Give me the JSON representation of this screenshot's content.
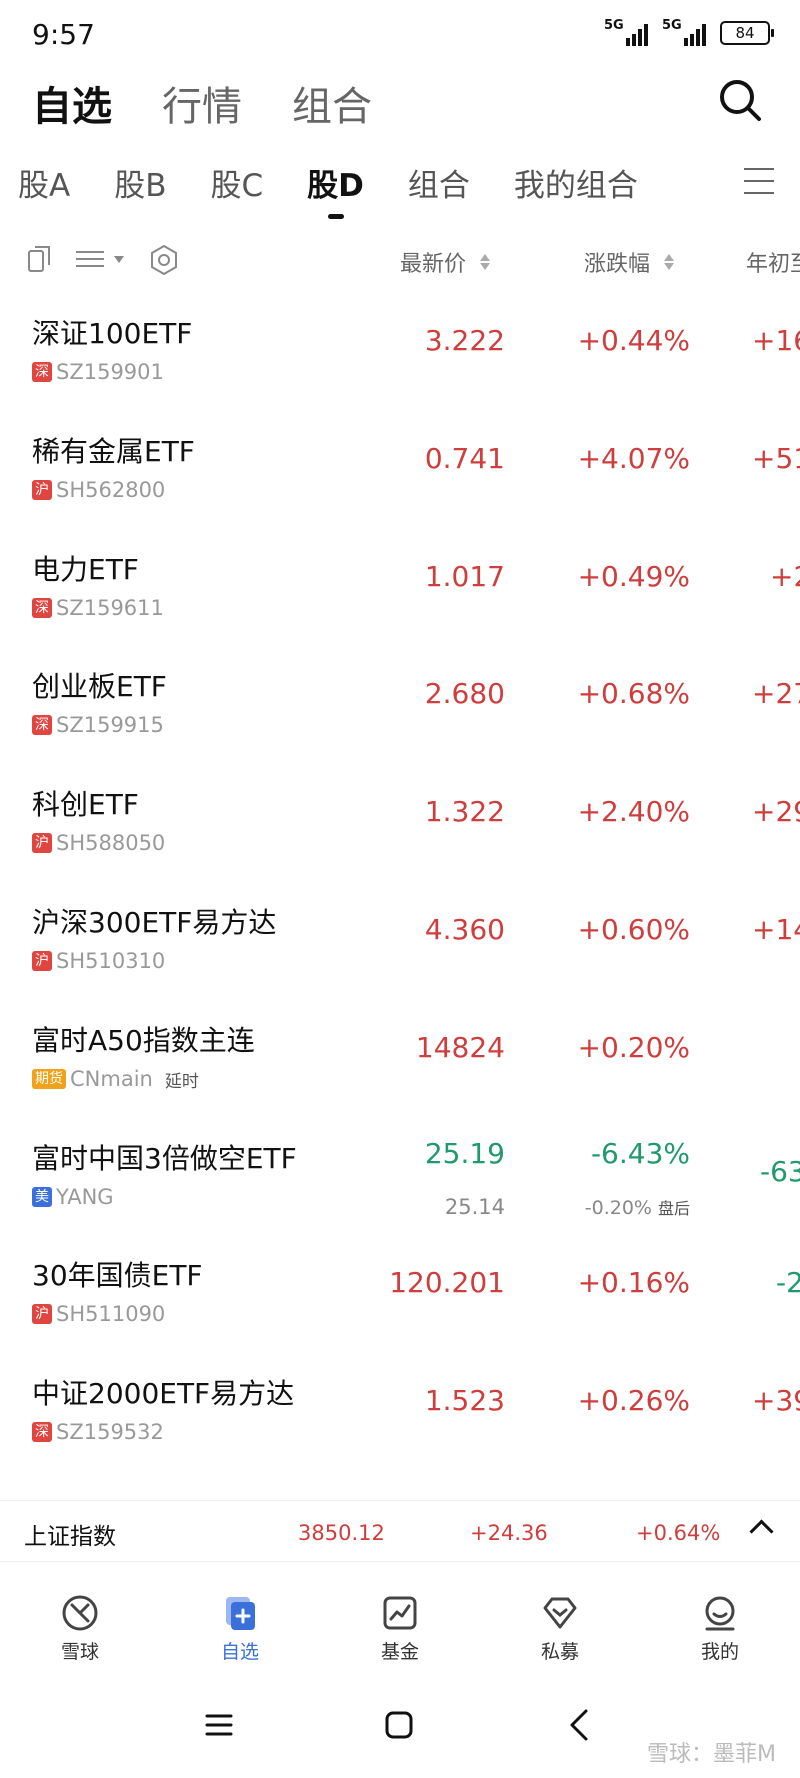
{
  "status": {
    "time": "9:57",
    "network1": "5G",
    "network2": "5G",
    "battery": "84"
  },
  "top_tabs": [
    {
      "label": "自选",
      "active": true
    },
    {
      "label": "行情",
      "active": false
    },
    {
      "label": "组合",
      "active": false
    }
  ],
  "group_tabs": [
    {
      "label": "股A",
      "active": false
    },
    {
      "label": "股B",
      "active": false
    },
    {
      "label": "股C",
      "active": false
    },
    {
      "label": "股D",
      "active": true
    },
    {
      "label": "组合",
      "active": false
    },
    {
      "label": "我的组合",
      "active": false
    }
  ],
  "columns": {
    "price": "最新价",
    "change": "涨跌幅",
    "ytd": "年初至"
  },
  "rows": [
    {
      "name": "深证100ETF",
      "market": "深",
      "code": "SZ159901",
      "price": "3.222",
      "change": "+0.44%",
      "ytd": "+16",
      "dir": "up"
    },
    {
      "name": "稀有金属ETF",
      "market": "沪",
      "code": "SH562800",
      "price": "0.741",
      "change": "+4.07%",
      "ytd": "+51",
      "dir": "up"
    },
    {
      "name": "电力ETF",
      "market": "深",
      "code": "SZ159611",
      "price": "1.017",
      "change": "+0.49%",
      "ytd": "+2",
      "dir": "up"
    },
    {
      "name": "创业板ETF",
      "market": "深",
      "code": "SZ159915",
      "price": "2.680",
      "change": "+0.68%",
      "ytd": "+27",
      "dir": "up"
    },
    {
      "name": "科创ETF",
      "market": "沪",
      "code": "SH588050",
      "price": "1.322",
      "change": "+2.40%",
      "ytd": "+29",
      "dir": "up"
    },
    {
      "name": "沪深300ETF易方达",
      "market": "沪",
      "code": "SH510310",
      "price": "4.360",
      "change": "+0.60%",
      "ytd": "+14",
      "dir": "up"
    },
    {
      "name": "富时A50指数主连",
      "market": "期货",
      "code": "CNmain",
      "delay": "延时",
      "price": "14824",
      "change": "+0.20%",
      "ytd": "",
      "dir": "up"
    },
    {
      "name": "富时中国3倍做空ETF",
      "market": "美",
      "code": "YANG",
      "price": "25.19",
      "change": "-6.43%",
      "price_after": "25.14",
      "change_after": "-0.20%",
      "after_label": "盘后",
      "ytd": "-63",
      "dir": "down"
    },
    {
      "name": "30年国债ETF",
      "market": "沪",
      "code": "SH511090",
      "price": "120.201",
      "change": "+0.16%",
      "ytd": "-2",
      "dir": "mixed"
    },
    {
      "name": "中证2000ETF易方达",
      "market": "深",
      "code": "SZ159532",
      "price": "1.523",
      "change": "+0.26%",
      "ytd": "+39",
      "dir": "up"
    }
  ],
  "ticker": {
    "name": "上证指数",
    "value": "3850.12",
    "change": "+24.36",
    "percent": "+0.64%"
  },
  "bottom_nav": [
    {
      "label": "雪球",
      "icon": "xueqiu-icon",
      "active": false
    },
    {
      "label": "自选",
      "icon": "watchlist-icon",
      "active": true
    },
    {
      "label": "基金",
      "icon": "fund-chart-icon",
      "active": false
    },
    {
      "label": "私募",
      "icon": "private-fund-icon",
      "active": false
    },
    {
      "label": "我的",
      "icon": "profile-icon",
      "active": false
    }
  ],
  "watermark": "雪球：墨菲M",
  "colors": {
    "up": "#cf3d3d",
    "down": "#1f9a6a",
    "accent": "#3b6fd9",
    "badge_sz": "#e0453f",
    "badge_sh": "#e0453f",
    "badge_fut": "#f0a21a",
    "badge_us": "#3b6fd9"
  }
}
